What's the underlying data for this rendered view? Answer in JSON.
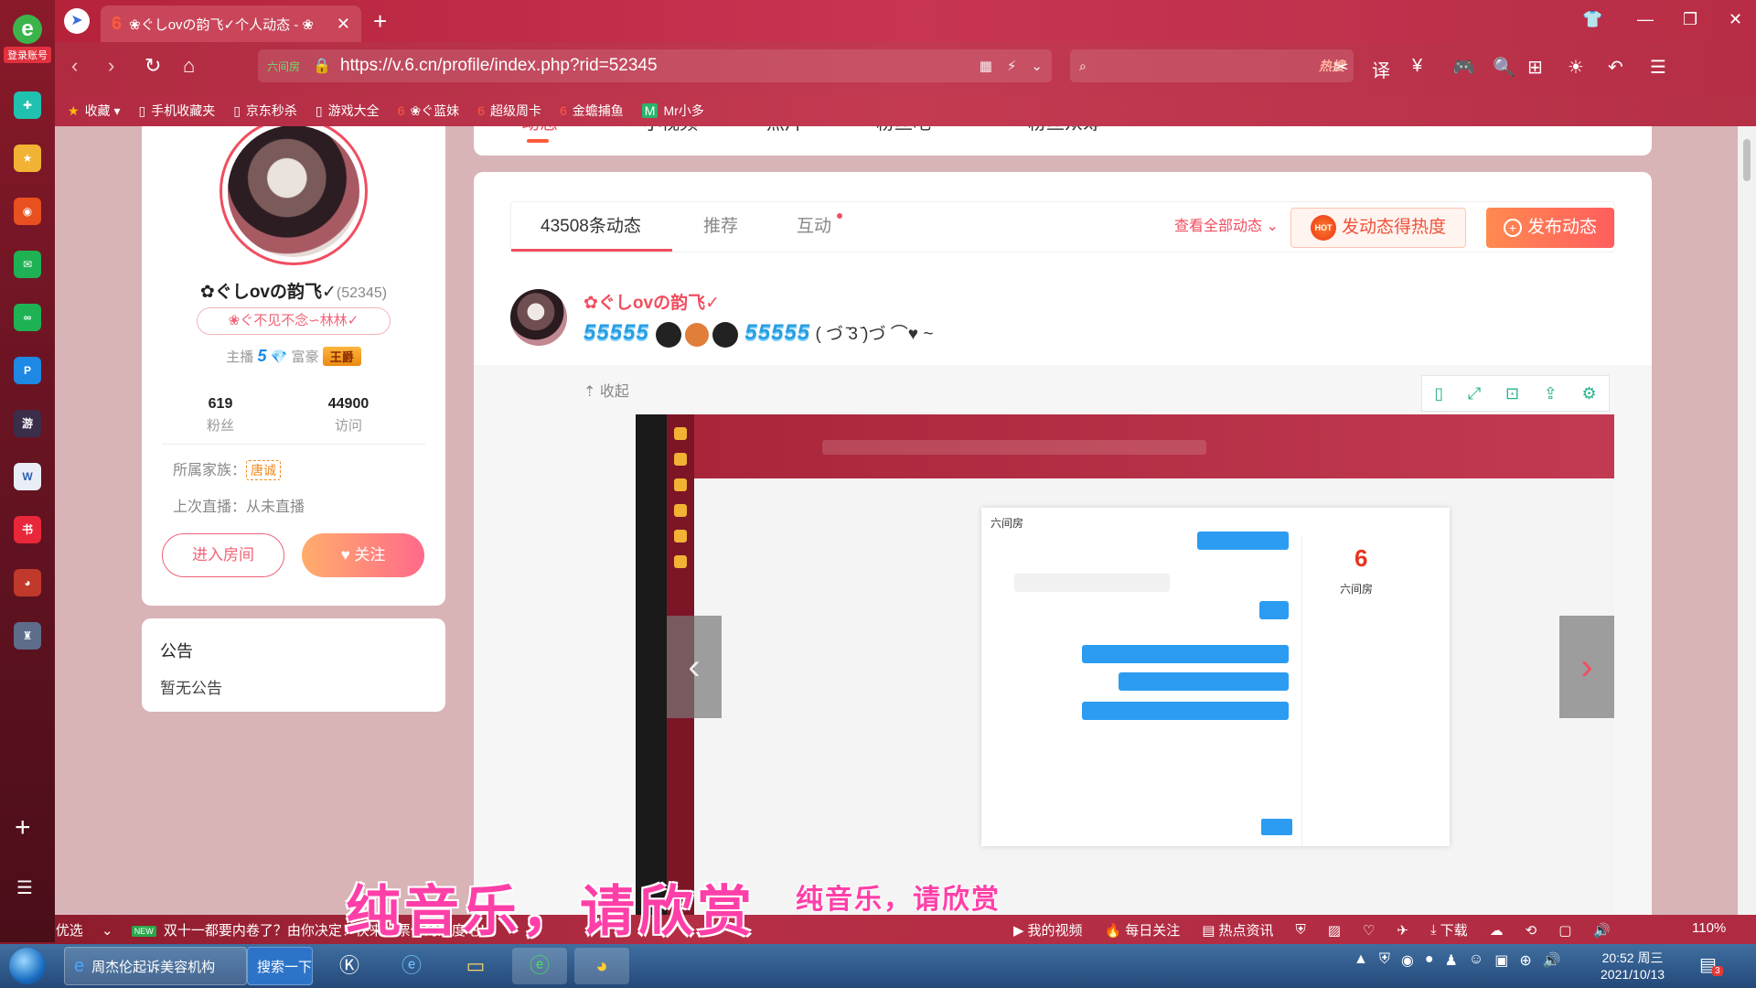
{
  "sidebar": {
    "logo_letter": "e",
    "login_label": "登录账号",
    "items": [
      {
        "icon": "plus-cross-icon",
        "glyph": "✚",
        "color": "#21c1b0"
      },
      {
        "icon": "star-icon",
        "glyph": "★",
        "color": "#f2b233"
      },
      {
        "icon": "weibo-icon",
        "glyph": "◉",
        "color": "#e8501f"
      },
      {
        "icon": "mail-icon",
        "glyph": "✉",
        "color": "#1fb254"
      },
      {
        "icon": "chain-icon",
        "glyph": "∞",
        "color": "#1fb254"
      },
      {
        "icon": "p-icon",
        "glyph": "P",
        "color": "#1e88e5"
      },
      {
        "icon": "game-icon",
        "glyph": "游",
        "color": "#3a2e4a"
      },
      {
        "icon": "word-icon",
        "glyph": "W",
        "color": "#e9eef6"
      },
      {
        "icon": "xhs-icon",
        "glyph": "书",
        "color": "#e8283a"
      },
      {
        "icon": "avatar-game-icon",
        "glyph": "◕",
        "color": "#c0392b"
      },
      {
        "icon": "castle-icon",
        "glyph": "♜",
        "color": "#5d6d8a"
      }
    ]
  },
  "titlebar": {
    "tab_title": "❀ぐしovの韵飞✓个人动态 - ❀",
    "tab_brand": "6"
  },
  "address": {
    "site_tag": "六间房",
    "url": "https://v.6.cn/profile/index.php?rid=52345",
    "search_hot": "热搜"
  },
  "bookmarks": [
    {
      "icon": "star-icon",
      "glyph": "★",
      "label": "收藏 ▾"
    },
    {
      "icon": "file-icon",
      "glyph": "▯",
      "label": "手机收藏夹"
    },
    {
      "icon": "file-icon",
      "glyph": "▯",
      "label": "京东秒杀"
    },
    {
      "icon": "file-icon",
      "glyph": "▯",
      "label": "游戏大全"
    },
    {
      "icon": "six-icon",
      "glyph": "6",
      "label": "❀ぐ蓝妹"
    },
    {
      "icon": "six-icon",
      "glyph": "6",
      "label": "超级周卡"
    },
    {
      "icon": "six-icon",
      "glyph": "6",
      "label": "金蟾捕鱼"
    },
    {
      "icon": "mr-icon",
      "glyph": "M",
      "label": "Mr小多"
    }
  ],
  "profile_nav": {
    "tabs": [
      "动态",
      "小视频",
      "照片",
      "粉丝吧",
      "粉丝众筹"
    ]
  },
  "profile": {
    "nickname": "✿ぐしovの韵飞✓",
    "rid": "(52345)",
    "signature": "❀ぐ不见不念∽林林✓",
    "anchor_label": "主播",
    "anchor_level": "5",
    "rich_label": "富豪",
    "rich_badge": "王爵",
    "fans_count": "619",
    "fans_label": "粉丝",
    "visits_count": "44900",
    "visits_label": "访问",
    "family_label": "所属家族：",
    "family_tag": "唐诚",
    "last_live": "上次直播：从未直播",
    "enter_room": "进入房间",
    "follow": "关注"
  },
  "notice": {
    "title": "公告",
    "content": "暂无公告"
  },
  "feed": {
    "tab_count": "43508条动态",
    "tab_recommend": "推荐",
    "tab_interact": "互动",
    "view_all": "查看全部动态",
    "heat_button": "发动态得热度",
    "heat_badge": "HOT",
    "post_button": "发布动态",
    "post": {
      "author": "✿ぐしovの韵飞✓",
      "content_tail": "( づ ̄3 ̄)づ ⌒♥ ~",
      "collapse": "收起"
    },
    "embedded": {
      "chat_header": "六间房",
      "brand": "6",
      "brand_name": "六间房"
    }
  },
  "overlay": {
    "subtitle_big": "纯音乐，请欣赏",
    "subtitle_small": "纯音乐，请欣赏"
  },
  "statusbar": {
    "left_label": "今日优选",
    "new_badge": "NEW",
    "news": "双十一都要内卷了？由你决定！快来投票你的态度吧！",
    "my_video": "我的视频",
    "daily_follow": "每日关注",
    "hot_news": "热点资讯",
    "download": "下载",
    "zoom": "110%"
  },
  "taskbar": {
    "ie_task": "周杰伦起诉美容机构",
    "search_btn": "搜索一下",
    "time": "20:52 周三",
    "date": "2021/10/13",
    "notif_count": "3"
  }
}
